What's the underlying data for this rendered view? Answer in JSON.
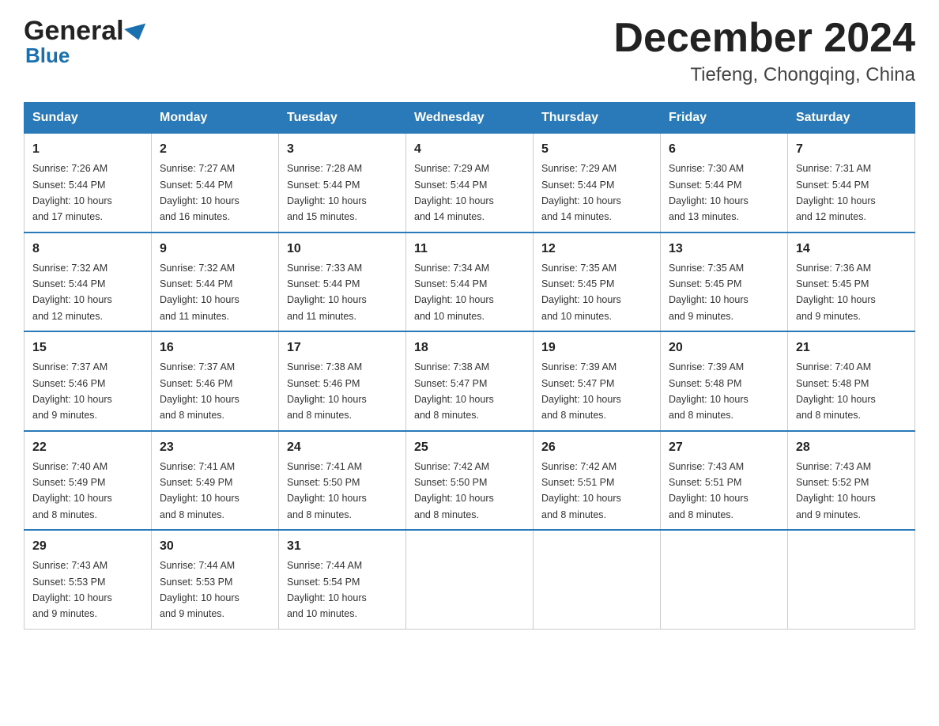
{
  "header": {
    "logo_line1": "General",
    "logo_line2": "Blue",
    "month_title": "December 2024",
    "location": "Tiefeng, Chongqing, China"
  },
  "weekdays": [
    "Sunday",
    "Monday",
    "Tuesday",
    "Wednesday",
    "Thursday",
    "Friday",
    "Saturday"
  ],
  "weeks": [
    [
      {
        "day": "1",
        "sunrise": "7:26 AM",
        "sunset": "5:44 PM",
        "daylight": "10 hours and 17 minutes."
      },
      {
        "day": "2",
        "sunrise": "7:27 AM",
        "sunset": "5:44 PM",
        "daylight": "10 hours and 16 minutes."
      },
      {
        "day": "3",
        "sunrise": "7:28 AM",
        "sunset": "5:44 PM",
        "daylight": "10 hours and 15 minutes."
      },
      {
        "day": "4",
        "sunrise": "7:29 AM",
        "sunset": "5:44 PM",
        "daylight": "10 hours and 14 minutes."
      },
      {
        "day": "5",
        "sunrise": "7:29 AM",
        "sunset": "5:44 PM",
        "daylight": "10 hours and 14 minutes."
      },
      {
        "day": "6",
        "sunrise": "7:30 AM",
        "sunset": "5:44 PM",
        "daylight": "10 hours and 13 minutes."
      },
      {
        "day": "7",
        "sunrise": "7:31 AM",
        "sunset": "5:44 PM",
        "daylight": "10 hours and 12 minutes."
      }
    ],
    [
      {
        "day": "8",
        "sunrise": "7:32 AM",
        "sunset": "5:44 PM",
        "daylight": "10 hours and 12 minutes."
      },
      {
        "day": "9",
        "sunrise": "7:32 AM",
        "sunset": "5:44 PM",
        "daylight": "10 hours and 11 minutes."
      },
      {
        "day": "10",
        "sunrise": "7:33 AM",
        "sunset": "5:44 PM",
        "daylight": "10 hours and 11 minutes."
      },
      {
        "day": "11",
        "sunrise": "7:34 AM",
        "sunset": "5:44 PM",
        "daylight": "10 hours and 10 minutes."
      },
      {
        "day": "12",
        "sunrise": "7:35 AM",
        "sunset": "5:45 PM",
        "daylight": "10 hours and 10 minutes."
      },
      {
        "day": "13",
        "sunrise": "7:35 AM",
        "sunset": "5:45 PM",
        "daylight": "10 hours and 9 minutes."
      },
      {
        "day": "14",
        "sunrise": "7:36 AM",
        "sunset": "5:45 PM",
        "daylight": "10 hours and 9 minutes."
      }
    ],
    [
      {
        "day": "15",
        "sunrise": "7:37 AM",
        "sunset": "5:46 PM",
        "daylight": "10 hours and 9 minutes."
      },
      {
        "day": "16",
        "sunrise": "7:37 AM",
        "sunset": "5:46 PM",
        "daylight": "10 hours and 8 minutes."
      },
      {
        "day": "17",
        "sunrise": "7:38 AM",
        "sunset": "5:46 PM",
        "daylight": "10 hours and 8 minutes."
      },
      {
        "day": "18",
        "sunrise": "7:38 AM",
        "sunset": "5:47 PM",
        "daylight": "10 hours and 8 minutes."
      },
      {
        "day": "19",
        "sunrise": "7:39 AM",
        "sunset": "5:47 PM",
        "daylight": "10 hours and 8 minutes."
      },
      {
        "day": "20",
        "sunrise": "7:39 AM",
        "sunset": "5:48 PM",
        "daylight": "10 hours and 8 minutes."
      },
      {
        "day": "21",
        "sunrise": "7:40 AM",
        "sunset": "5:48 PM",
        "daylight": "10 hours and 8 minutes."
      }
    ],
    [
      {
        "day": "22",
        "sunrise": "7:40 AM",
        "sunset": "5:49 PM",
        "daylight": "10 hours and 8 minutes."
      },
      {
        "day": "23",
        "sunrise": "7:41 AM",
        "sunset": "5:49 PM",
        "daylight": "10 hours and 8 minutes."
      },
      {
        "day": "24",
        "sunrise": "7:41 AM",
        "sunset": "5:50 PM",
        "daylight": "10 hours and 8 minutes."
      },
      {
        "day": "25",
        "sunrise": "7:42 AM",
        "sunset": "5:50 PM",
        "daylight": "10 hours and 8 minutes."
      },
      {
        "day": "26",
        "sunrise": "7:42 AM",
        "sunset": "5:51 PM",
        "daylight": "10 hours and 8 minutes."
      },
      {
        "day": "27",
        "sunrise": "7:43 AM",
        "sunset": "5:51 PM",
        "daylight": "10 hours and 8 minutes."
      },
      {
        "day": "28",
        "sunrise": "7:43 AM",
        "sunset": "5:52 PM",
        "daylight": "10 hours and 9 minutes."
      }
    ],
    [
      {
        "day": "29",
        "sunrise": "7:43 AM",
        "sunset": "5:53 PM",
        "daylight": "10 hours and 9 minutes."
      },
      {
        "day": "30",
        "sunrise": "7:44 AM",
        "sunset": "5:53 PM",
        "daylight": "10 hours and 9 minutes."
      },
      {
        "day": "31",
        "sunrise": "7:44 AM",
        "sunset": "5:54 PM",
        "daylight": "10 hours and 10 minutes."
      },
      null,
      null,
      null,
      null
    ]
  ],
  "labels": {
    "sunrise": "Sunrise:",
    "sunset": "Sunset:",
    "daylight": "Daylight:"
  }
}
